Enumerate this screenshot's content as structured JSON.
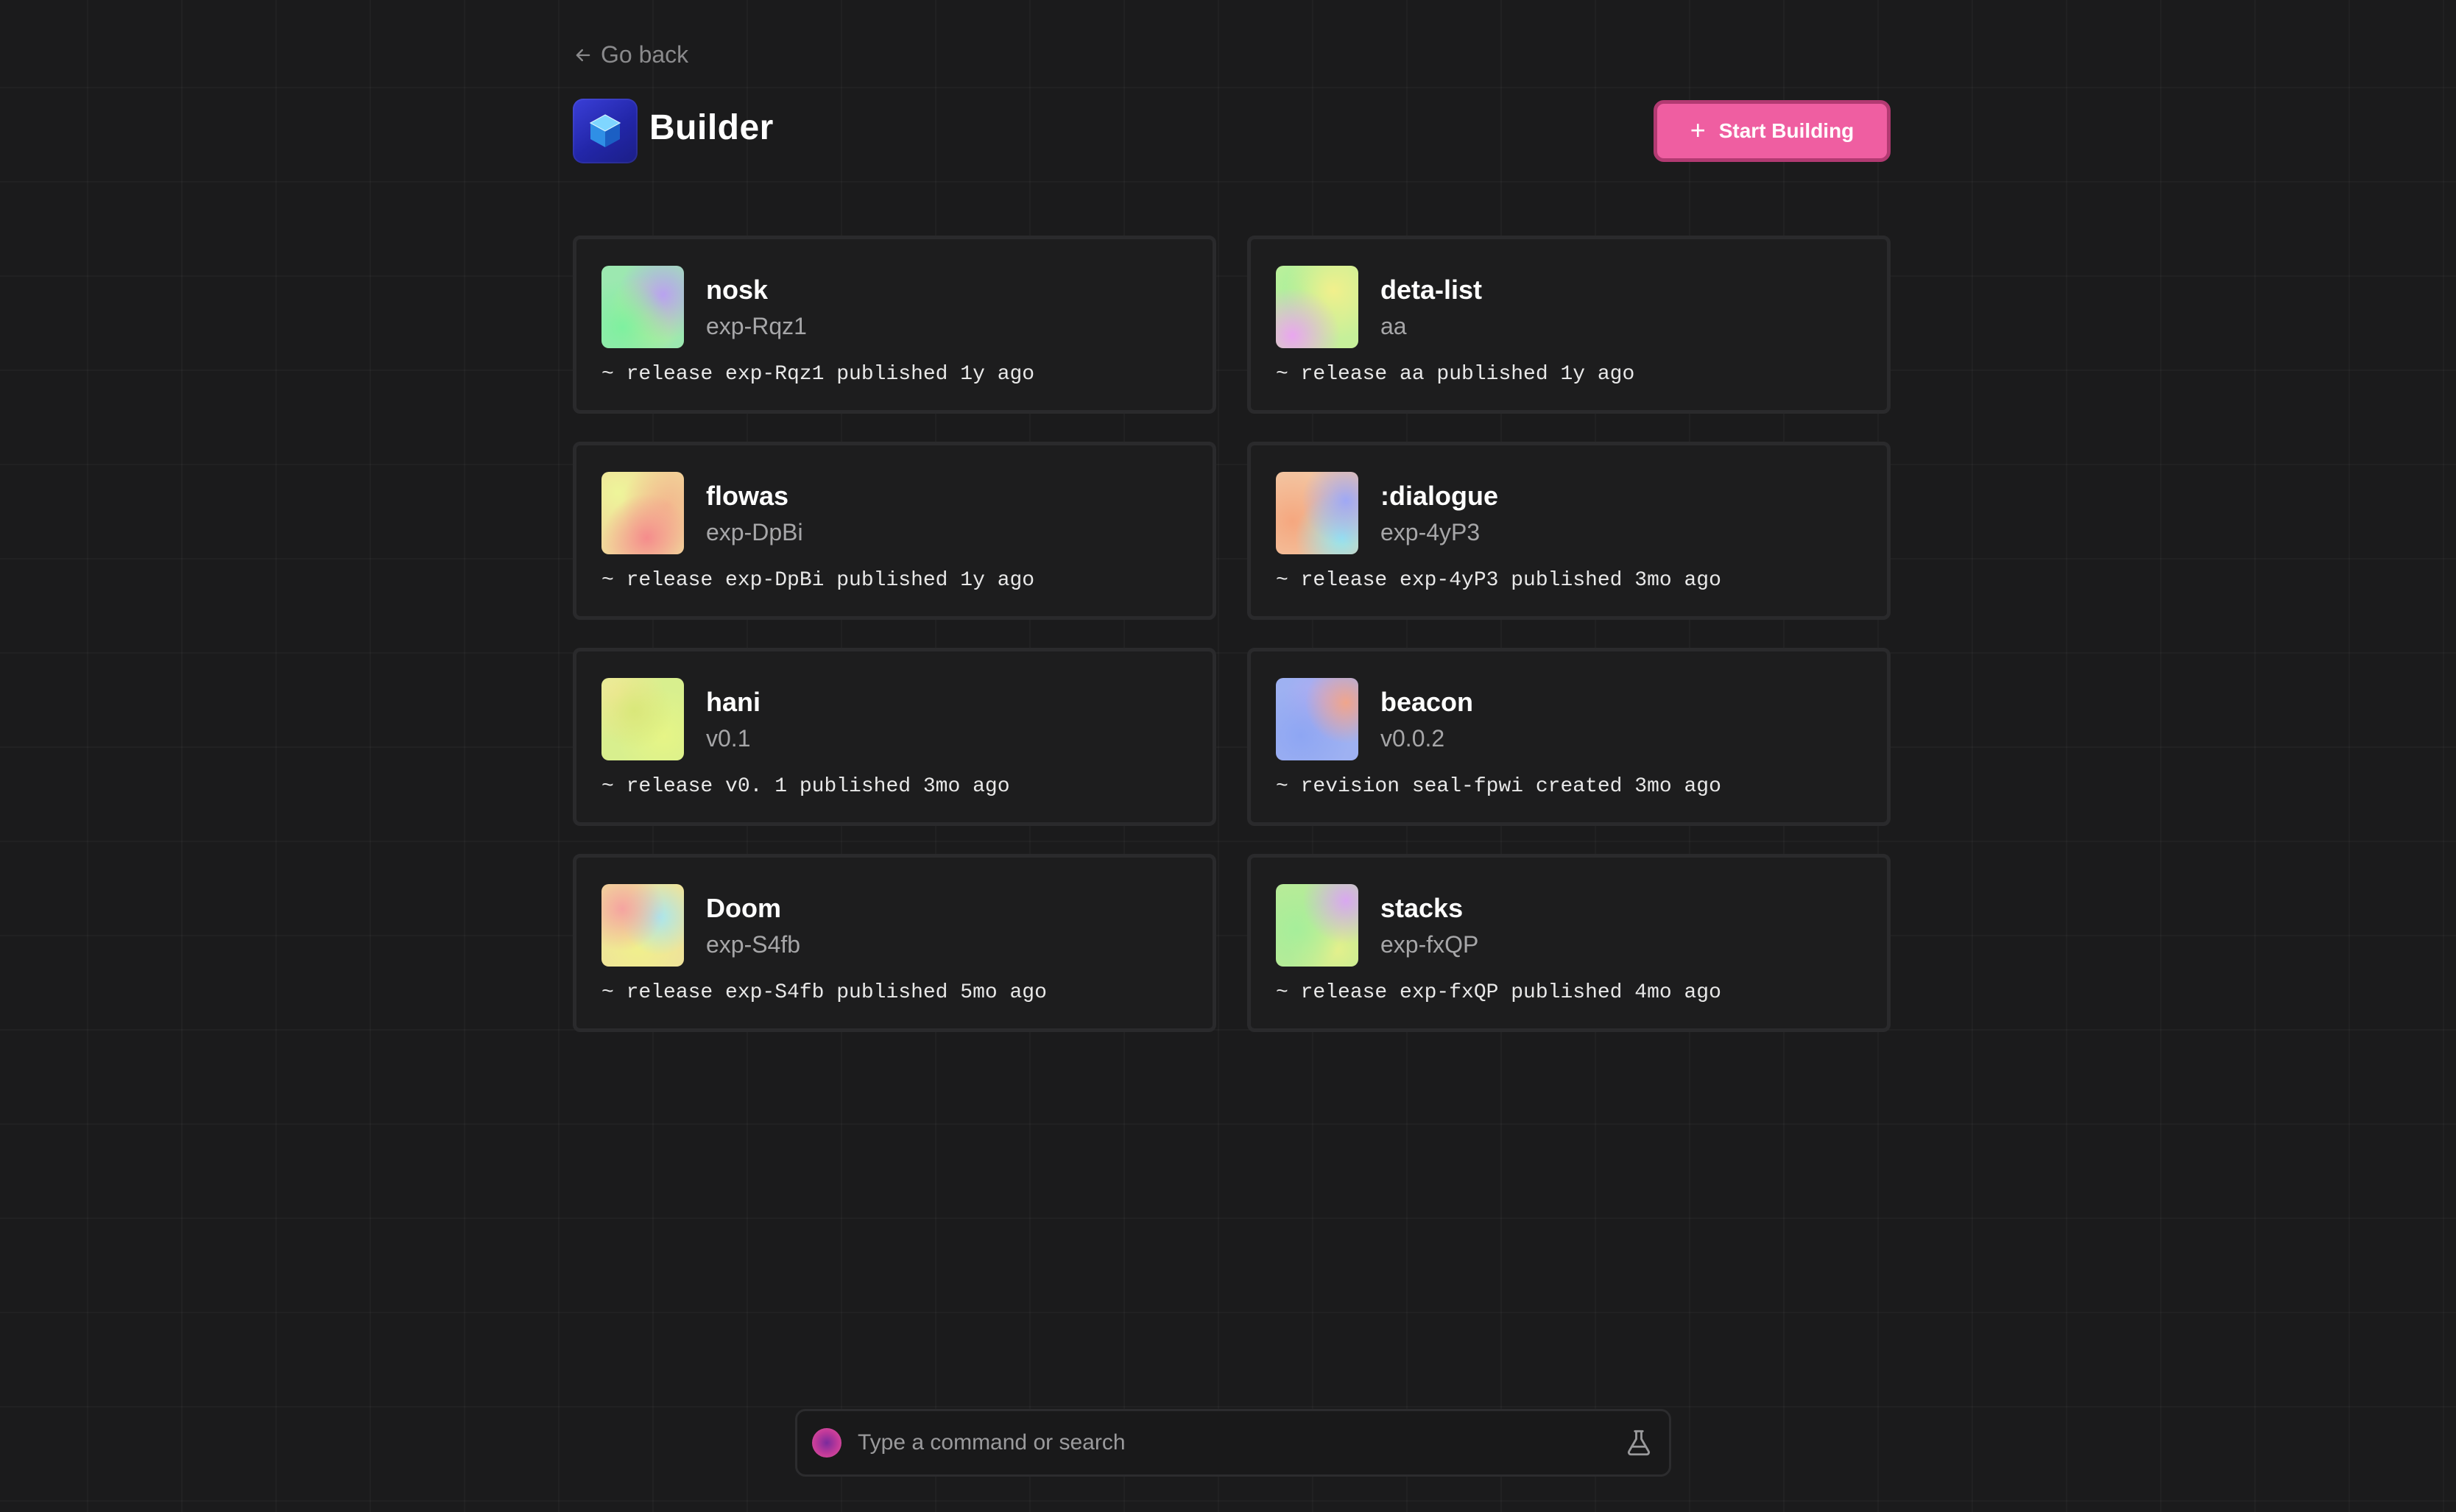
{
  "nav": {
    "back_label": "Go back"
  },
  "header": {
    "title": "Builder",
    "start_button_label": "Start Building"
  },
  "projects": [
    {
      "name": "nosk",
      "version": "exp-Rqz1",
      "meta": "~ release exp-Rqz1 published 1y ago"
    },
    {
      "name": "deta-list",
      "version": "aa",
      "meta": "~ release aa published 1y ago"
    },
    {
      "name": "flowas",
      "version": "exp-DpBi",
      "meta": "~ release exp-DpBi published 1y ago"
    },
    {
      "name": ":dialogue",
      "version": "exp-4yP3",
      "meta": "~ release exp-4yP3 published 3mo ago"
    },
    {
      "name": "hani",
      "version": "v0.1",
      "meta": "~ release v0. 1 published 3mo ago"
    },
    {
      "name": "beacon",
      "version": "v0.0.2",
      "meta": "~ revision seal-fpwi created 3mo ago"
    },
    {
      "name": "Doom",
      "version": "exp-S4fb",
      "meta": "~ release exp-S4fb published 5mo ago"
    },
    {
      "name": "stacks",
      "version": "exp-fxQP",
      "meta": "~ release exp-fxQP published 4mo ago"
    }
  ],
  "command_bar": {
    "placeholder": "Type a command or search"
  },
  "colors": {
    "background": "#1b1b1c",
    "accent": "#ef5ea1",
    "logo": "#2a2fc4"
  },
  "icons": {
    "back": "arrow-left-icon",
    "logo": "cube-icon",
    "add": "plus-icon",
    "command": "orb-icon",
    "labs": "flask-icon"
  }
}
